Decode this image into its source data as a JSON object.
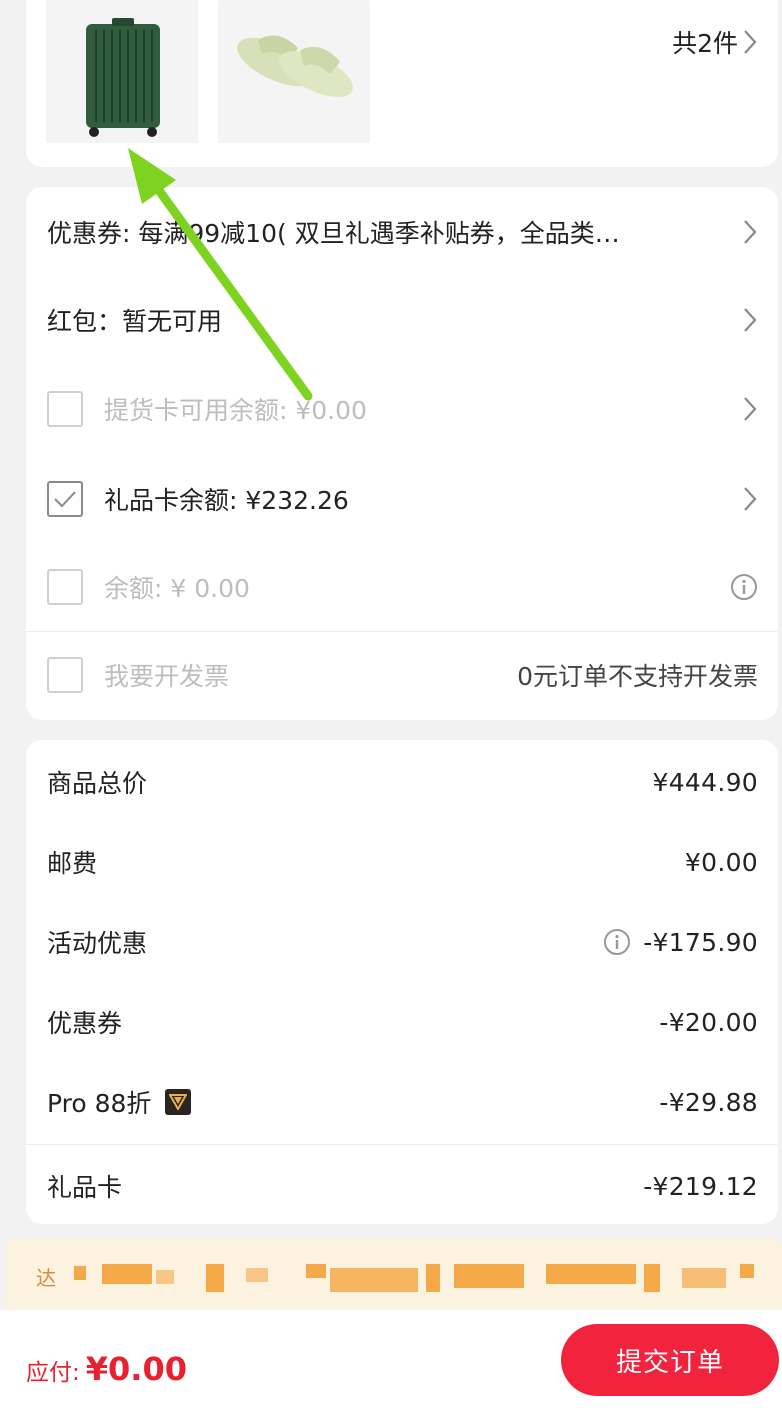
{
  "products": {
    "count_label": "共2件",
    "items": [
      {
        "name": "suitcase-thumbnail"
      },
      {
        "name": "slippers-thumbnail"
      }
    ]
  },
  "payments": {
    "coupon": "优惠券: 每满99减10( 双旦礼遇季补贴券，全品类…",
    "red_packet": "红包：暂无可用",
    "pickup_card": "提货卡可用余额: ¥0.00",
    "gift_card": "礼品卡余额: ¥232.26",
    "balance": "余额: ¥ 0.00",
    "invoice": "我要开发票",
    "invoice_note": "0元订单不支持开发票"
  },
  "summary": {
    "rows": [
      {
        "label": "商品总价",
        "value": "¥444.90"
      },
      {
        "label": "邮费",
        "value": "¥0.00"
      },
      {
        "label": "活动优惠",
        "value": "-¥175.90"
      },
      {
        "label": "优惠券",
        "value": "-¥20.00"
      },
      {
        "label": "Pro 88折",
        "value": "-¥29.88"
      },
      {
        "label": "礼品卡",
        "value": "-¥219.12"
      }
    ]
  },
  "notice": {
    "text": "达"
  },
  "footer": {
    "pay_label": "应付:",
    "pay_amount": "¥0.00",
    "submit_label": "提交订单"
  },
  "colors": {
    "accent": "#f2233d",
    "annotation_arrow": "#7ed321"
  }
}
